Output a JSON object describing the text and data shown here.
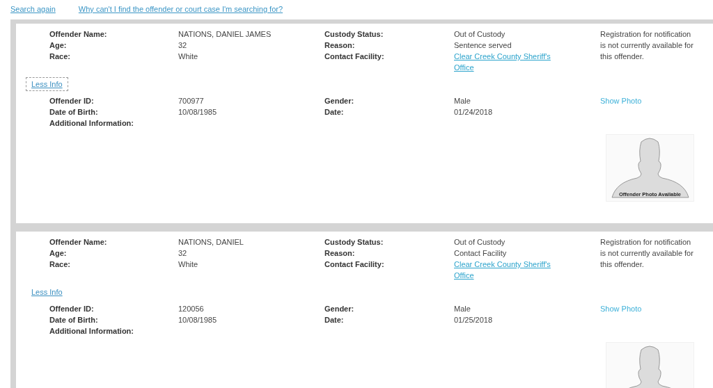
{
  "top_links": [
    {
      "label": "Search again"
    },
    {
      "label": "Why can't I find the offender or court case I'm searching for?"
    }
  ],
  "records": [
    {
      "summary_left": [
        {
          "label": "Offender Name:",
          "value": "NATIONS, DANIEL JAMES"
        },
        {
          "label": "Age:",
          "value": "32"
        },
        {
          "label": "Race:",
          "value": "White"
        }
      ],
      "summary_right": [
        {
          "label": "Custody Status:",
          "value": "Out of Custody",
          "kind": "text"
        },
        {
          "label": "Reason:",
          "value": "Sentence served",
          "kind": "text"
        },
        {
          "label": "Contact Facility:",
          "value": "Clear Creek County Sheriff's Office",
          "kind": "link"
        }
      ],
      "notice": "Registration for notification is not currently available for this offender.",
      "toggle": {
        "label": "Less Info",
        "focused": true
      },
      "details_left": [
        {
          "label": "Offender ID:",
          "value": "700977"
        },
        {
          "label": "Date of Birth:",
          "value": "10/08/1985"
        },
        {
          "label": "Additional Information:"
        }
      ],
      "details_right": [
        {
          "label": "Gender:",
          "value": "Male"
        },
        {
          "label": "Date:",
          "value": "01/24/2018"
        }
      ],
      "show_photo": "Show Photo",
      "photo": {
        "caption": "Offender Photo Available"
      }
    },
    {
      "summary_left": [
        {
          "label": "Offender Name:",
          "value": "NATIONS, DANIEL"
        },
        {
          "label": "Age:",
          "value": "32"
        },
        {
          "label": "Race:",
          "value": "White"
        }
      ],
      "summary_right": [
        {
          "label": "Custody Status:",
          "value": "Out of Custody",
          "kind": "text"
        },
        {
          "label": "Reason:",
          "value": "Contact Facility",
          "kind": "text"
        },
        {
          "label": "Contact Facility:",
          "value": "Clear Creek County Sheriff's Office",
          "kind": "link"
        }
      ],
      "notice": "Registration for notification is not currently available for this offender.",
      "toggle": {
        "label": "Less Info",
        "focused": false
      },
      "details_left": [
        {
          "label": "Offender ID:",
          "value": "120056"
        },
        {
          "label": "Date of Birth:",
          "value": "10/08/1985"
        },
        {
          "label": "Additional Information:"
        }
      ],
      "details_right": [
        {
          "label": "Gender:",
          "value": "Male"
        },
        {
          "label": "Date:",
          "value": "01/25/2018"
        }
      ],
      "show_photo": "Show Photo"
    }
  ]
}
